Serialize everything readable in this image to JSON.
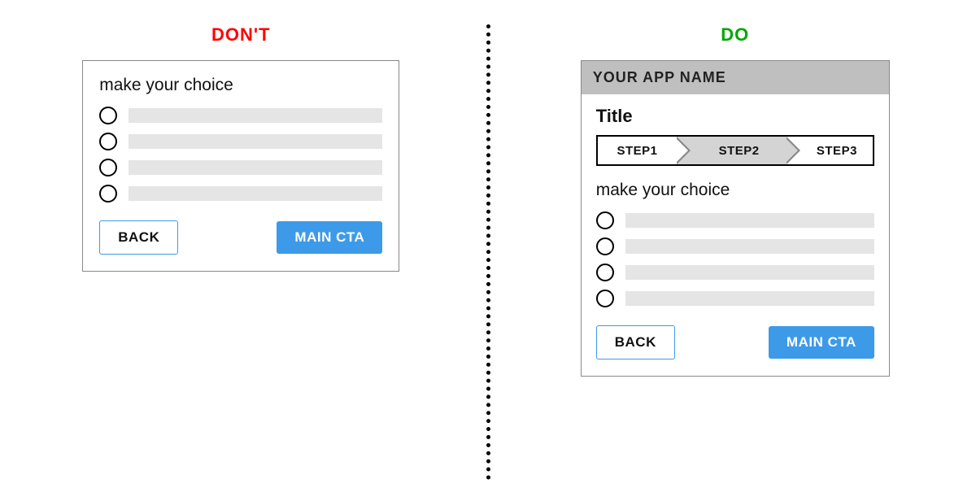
{
  "labels": {
    "dont": "DON'T",
    "do": "DO"
  },
  "dont_panel": {
    "prompt": "make your choice",
    "back_button": "BACK",
    "cta_button": "MAIN CTA"
  },
  "do_panel": {
    "app_name": "YOUR APP NAME",
    "title": "Title",
    "steps": {
      "step1": "STEP1",
      "step2": "STEP2",
      "step3": "STEP3"
    },
    "prompt": "make your choice",
    "back_button": "BACK",
    "cta_button": "MAIN CTA"
  }
}
